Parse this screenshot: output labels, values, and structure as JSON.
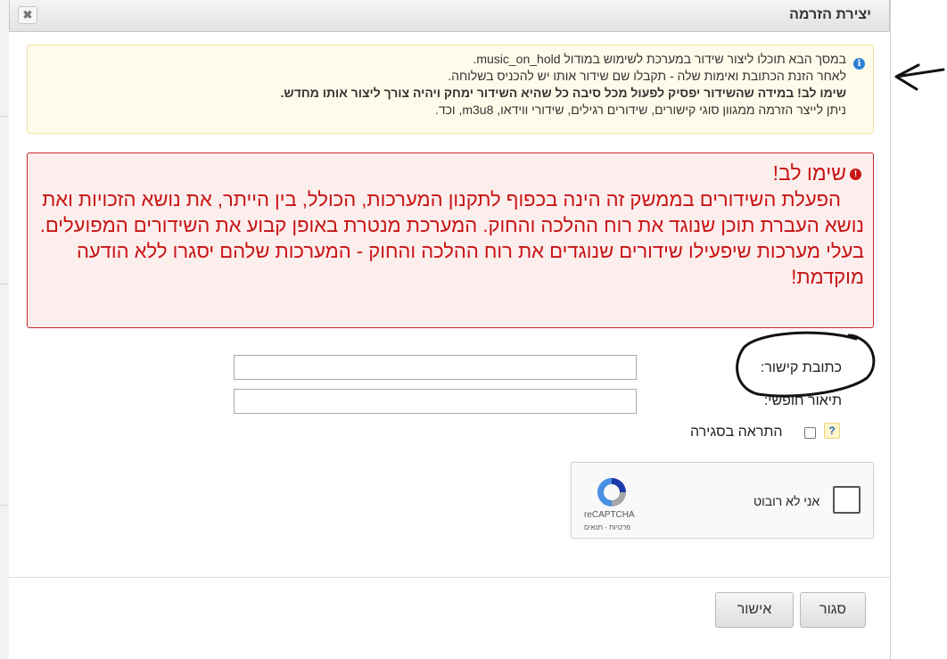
{
  "dialog": {
    "title": "יצירת הזרמה",
    "close_label": "✖"
  },
  "info": {
    "line1": "במסך הבא תוכלו ליצור שידור במערכת לשימוש במודול music_on_hold.",
    "line2": "לאחר הזנת הכתובת ואימות שלה - תקבלו שם שידור אותו יש להכניס בשלוחה.",
    "line3": "שימו לב! במידה שהשידור יפסיק לפעול מכל סיבה כל שהיא השידור ימחק ויהיה צורך ליצור אותו מחדש.",
    "line4": "ניתן לייצר הזרמה ממגוון סוגי קישורים, שידורים רגילים, שידורי ווידאו, m3u8, וכד."
  },
  "alert": {
    "title": "שימו לב!",
    "body": "הפעלת השידורים בממשק זה הינה בכפוף לתקנון המערכות, הכולל, בין הייתר, את נושא הזכויות ואת נושא העברת תוכן שנוגד את רוח ההלכה והחוק. המערכת מנטרת באופן קבוע את השידורים המפועלים. בעלי מערכות שיפעילו שידורים שנוגדים את רוח ההלכה והחוק - המערכות שלהם יסגרו ללא הודעה מוקדמת!"
  },
  "form": {
    "url_label": "כתובת קישור:",
    "url_value": "",
    "desc_label": "תיאור חופשי:",
    "desc_value": "",
    "help_label": "?",
    "notify_label": "התראה בסגירה",
    "notify_checked": false
  },
  "captcha": {
    "label": "אני לא רובוט",
    "brand": "reCAPTCHA",
    "links": "פרטיות - תנאים"
  },
  "buttons": {
    "close": "סגור",
    "confirm": "אישור"
  },
  "colors": {
    "alert_red": "#c81414",
    "info_blue": "#2a7fd4",
    "info_bg": "#fffbea"
  }
}
